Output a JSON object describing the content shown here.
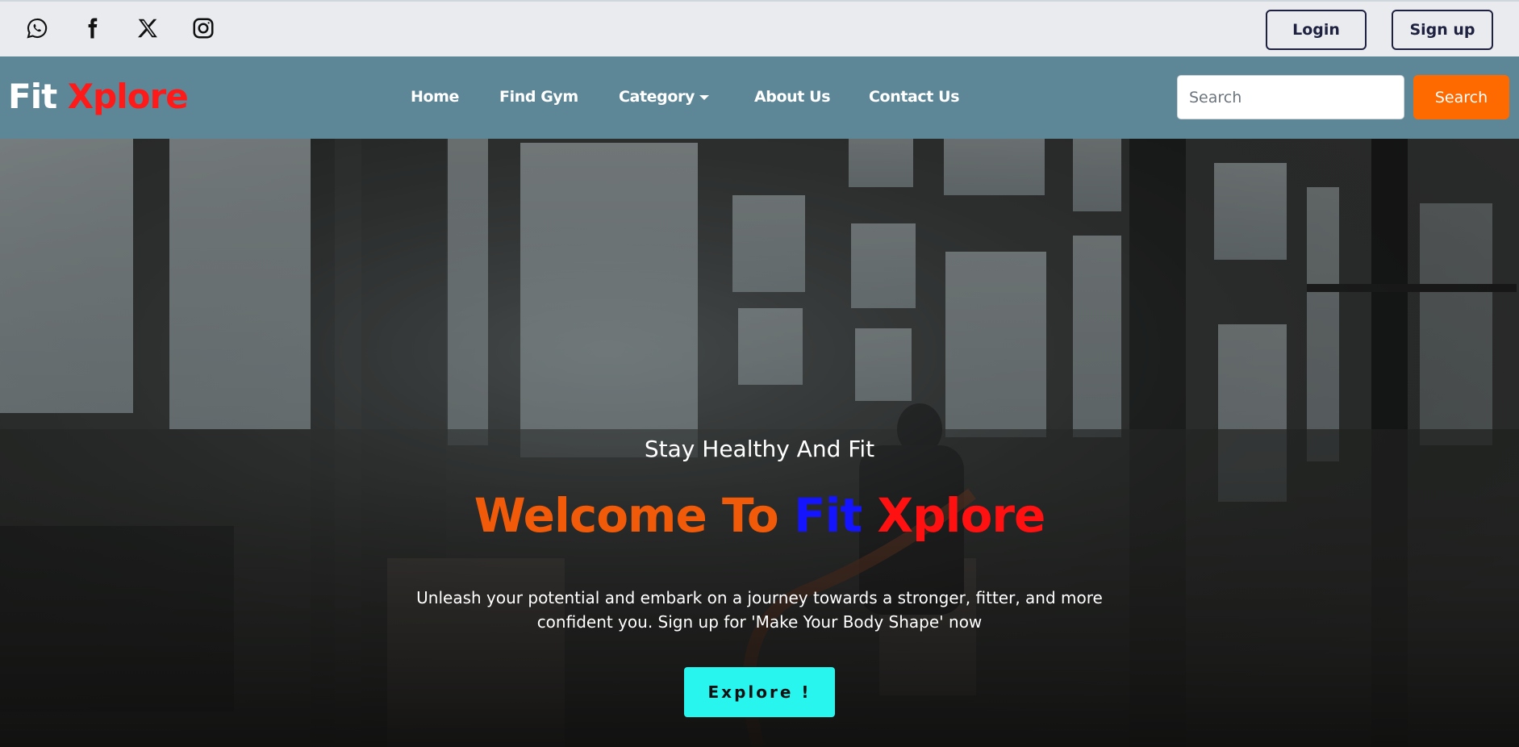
{
  "topbar": {
    "social": [
      {
        "icon": "whatsapp-icon"
      },
      {
        "icon": "facebook-icon"
      },
      {
        "icon": "x-icon"
      },
      {
        "icon": "instagram-icon"
      }
    ],
    "login_label": "Login",
    "signup_label": "Sign up"
  },
  "navbar": {
    "brand": {
      "part1": "Fit",
      "part2": "Xplore"
    },
    "links": [
      "Home",
      "Find Gym",
      "Category",
      "About Us",
      "Contact Us"
    ],
    "search_placeholder": "Search",
    "search_button": "Search"
  },
  "hero": {
    "subtitle": "Stay Healthy And Fit",
    "title": {
      "welcome": "Welcome To",
      "fit": "Fit",
      "xplore": "Xplore"
    },
    "description": "Unleash your potential and embark on a journey towards a stronger, fitter, and more confident you. Sign up for 'Make Your Body Shape' now",
    "cta": "Explore !"
  },
  "colors": {
    "topbar_bg": "#e9ebef",
    "navbar_bg": "#5d8797",
    "brand_accent": "#ff1a1a",
    "search_button": "#ff6a00",
    "cta": "#28f6ee",
    "title_orange": "#f05a09",
    "title_blue": "#1414ff",
    "title_red": "#ff1111"
  }
}
